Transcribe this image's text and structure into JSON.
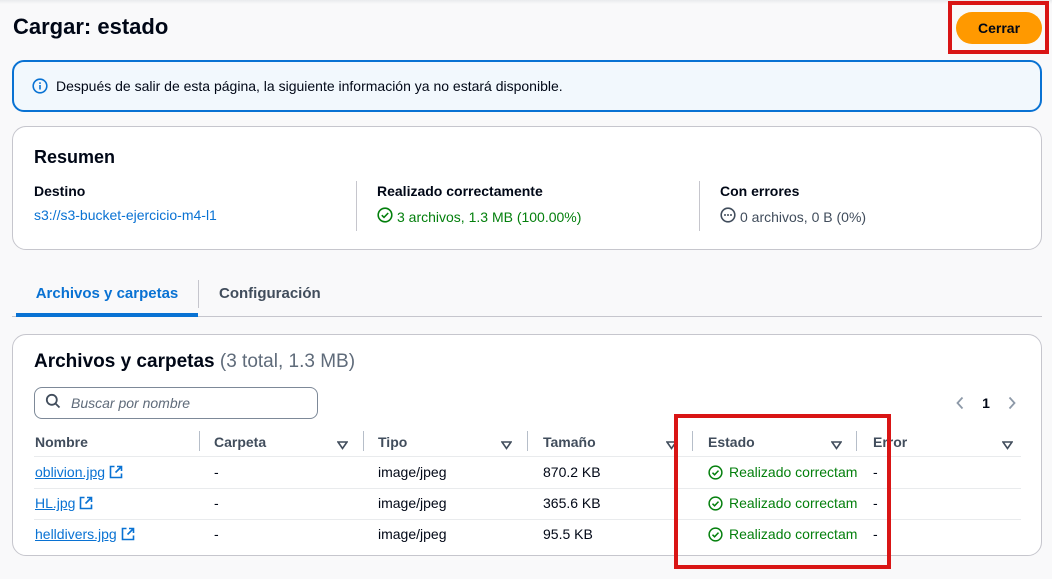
{
  "page": {
    "title": "Cargar: estado",
    "close_label": "Cerrar"
  },
  "alert": {
    "icon": "info-icon",
    "text": "Después de salir de esta página, la siguiente información ya no estará disponible."
  },
  "summary": {
    "title": "Resumen",
    "destination": {
      "label": "Destino",
      "value": "s3://s3-bucket-ejercicio-m4-l1"
    },
    "succeeded": {
      "label": "Realizado correctamente",
      "value": "3 archivos, 1.3 MB (100.00%)",
      "icon": "check-circle-icon"
    },
    "failed": {
      "label": "Con errores",
      "value": "0 archivos, 0 B (0%)",
      "icon": "error-circle-icon"
    }
  },
  "tabs": [
    {
      "label": "Archivos y carpetas",
      "active": true
    },
    {
      "label": "Configuración",
      "active": false
    }
  ],
  "files": {
    "title": "Archivos y carpetas",
    "count": "(3 total, 1.3 MB)",
    "search_placeholder": "Buscar por nombre",
    "page": "1",
    "columns": [
      "Nombre",
      "Carpeta",
      "Tipo",
      "Tamaño",
      "Estado",
      "Error"
    ],
    "rows": [
      {
        "name": "oblivion.jpg",
        "folder": "-",
        "type": "image/jpeg",
        "size": "870.2 KB",
        "status": "Realizado correctamente",
        "error": "-"
      },
      {
        "name": "HL.jpg",
        "folder": "-",
        "type": "image/jpeg",
        "size": "365.6 KB",
        "status": "Realizado correctamente",
        "error": "-"
      },
      {
        "name": "helldivers.jpg",
        "folder": "-",
        "type": "image/jpeg",
        "size": "95.5 KB",
        "status": "Realizado correctamente",
        "error": "-"
      }
    ]
  },
  "colors": {
    "accent": "#0972d3",
    "primary_button": "#ff9900",
    "success": "#037f0c",
    "highlight": "#d91515"
  }
}
